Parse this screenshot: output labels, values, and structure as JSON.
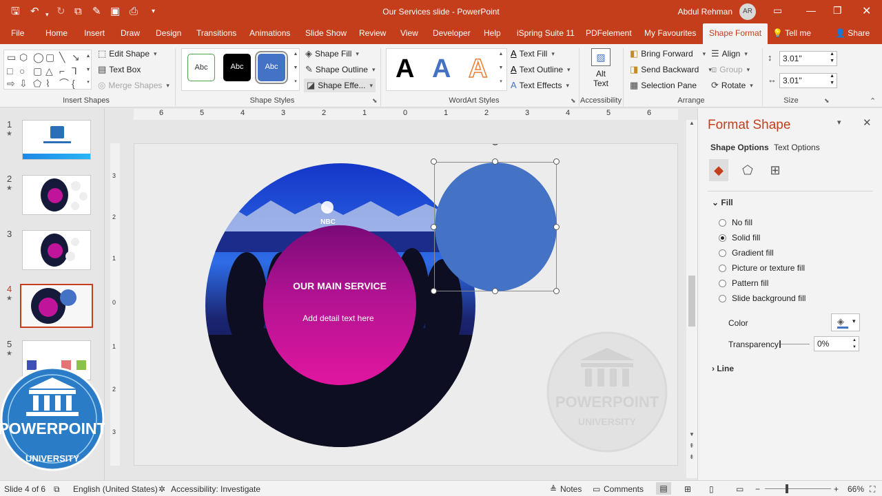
{
  "titlebar": {
    "title": "Our Services slide  -  PowerPoint",
    "user_name": "Abdul Rehman",
    "user_initials": "AR"
  },
  "tabs": [
    "File",
    "Home",
    "Insert",
    "Draw",
    "Design",
    "Transitions",
    "Animations",
    "Slide Show",
    "Review",
    "View",
    "Developer",
    "Help",
    "iSpring Suite 11",
    "PDFelement",
    "My Favourites",
    "Shape Format",
    "Tell me",
    "Share"
  ],
  "active_tab": "Shape Format",
  "ribbon": {
    "insert_shapes": {
      "label": "Insert Shapes",
      "edit_shape": "Edit Shape",
      "text_box": "Text Box",
      "merge_shapes": "Merge Shapes"
    },
    "shape_styles": {
      "label": "Shape Styles",
      "style1": "Abc",
      "style2": "Abc",
      "style3": "Abc",
      "shape_fill": "Shape Fill",
      "shape_outline": "Shape Outline",
      "shape_effects": "Shape Effe..."
    },
    "wordart": {
      "label": "WordArt Styles",
      "sample": "A",
      "text_fill": "Text Fill",
      "text_outline": "Text Outline",
      "text_effects": "Text Effects"
    },
    "accessibility": {
      "label": "Accessibility",
      "alt_text_1": "Alt",
      "alt_text_2": "Text"
    },
    "arrange": {
      "label": "Arrange",
      "bring_forward": "Bring Forward",
      "send_backward": "Send Backward",
      "selection_pane": "Selection Pane",
      "align": "Align",
      "group": "Group",
      "rotate": "Rotate"
    },
    "size": {
      "label": "Size",
      "height": "3.01\"",
      "width": "3.01\""
    }
  },
  "thumbnails": [
    {
      "num": "1",
      "star": "★"
    },
    {
      "num": "2",
      "star": "★"
    },
    {
      "num": "3",
      "star": ""
    },
    {
      "num": "4",
      "star": "★"
    },
    {
      "num": "5",
      "star": "★"
    }
  ],
  "logo": {
    "line1": "POWERPOINT",
    "line2": "UNIVERSITY"
  },
  "ruler": {
    "h": [
      "6",
      "5",
      "4",
      "3",
      "2",
      "1",
      "0",
      "1",
      "2",
      "3",
      "4",
      "5",
      "6"
    ],
    "v": [
      "3",
      "2",
      "1",
      "0",
      "1",
      "2",
      "3"
    ]
  },
  "slide": {
    "main_title": "OUR MAIN SERVICE",
    "main_sub": "Add detail text here",
    "photo_label": "NBC",
    "watermark_1": "POWERPOINT",
    "watermark_2": "UNIVERSITY"
  },
  "format_pane": {
    "title": "Format Shape",
    "tab_shape": "Shape Options",
    "tab_text": "Text Options",
    "fill_header": "Fill",
    "options": [
      {
        "label": "No fill",
        "checked": false
      },
      {
        "label": "Solid fill",
        "checked": true
      },
      {
        "label": "Gradient fill",
        "checked": false
      },
      {
        "label": "Picture or texture fill",
        "checked": false
      },
      {
        "label": "Pattern fill",
        "checked": false
      },
      {
        "label": "Slide background fill",
        "checked": false
      }
    ],
    "color_label": "Color",
    "transparency_label": "Transparency",
    "transparency_value": "0%",
    "line_header": "Line"
  },
  "statusbar": {
    "slide_info": "Slide 4 of 6",
    "language": "English (United States)",
    "accessibility": "Accessibility: Investigate",
    "notes": "Notes",
    "comments": "Comments",
    "zoom": "66%"
  },
  "colors": {
    "accent": "#c43e1c",
    "selected_shape": "#4472c4",
    "magenta_start": "#7a0a78",
    "magenta_end": "#e0169f"
  }
}
